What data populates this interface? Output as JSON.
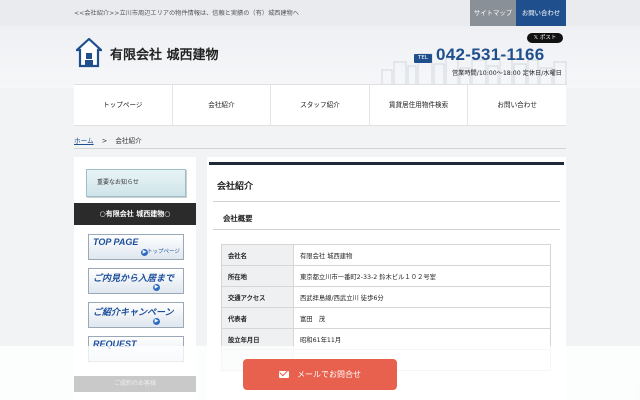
{
  "topbar": {
    "tagline": "<<会社紹介>>立川市周辺エリアの物件情報は、信頼と実績の（有）城西建物へ",
    "sitemap_label": "サイトマップ",
    "contact_label": "お問い合わせ"
  },
  "header": {
    "logo_text": "有限会社 城西建物",
    "post_label": "𝕏 ポスト",
    "tel_badge": "TEL",
    "tel_number": "042-531-1166",
    "hours": "営業時間/10:00～18:00 定休日/水曜日"
  },
  "nav": {
    "items": [
      {
        "label": "トップページ"
      },
      {
        "label": "会社紹介"
      },
      {
        "label": "スタッフ紹介"
      },
      {
        "label": "賃貸居住用物件検索"
      },
      {
        "label": "お問い合わせ"
      }
    ]
  },
  "breadcrumb": {
    "home": "ホーム",
    "separator": ">",
    "current": "会社紹介"
  },
  "sidebar": {
    "notice_label": "重要なお知らせ",
    "company_label": "○有限会社 城西建物○",
    "banners": [
      {
        "big": "TOP PAGE",
        "small": "トップページ"
      },
      {
        "big": "ご内見から入居まで",
        "small": ""
      },
      {
        "big": "ご紹介キャンペーン",
        "small": ""
      },
      {
        "big": "REQUEST",
        "small": ""
      }
    ],
    "faded_label": "ご成約のお客様"
  },
  "main": {
    "page_title": "会社紹介",
    "section_title": "会社概要",
    "rows": [
      {
        "label": "会社名",
        "value": "有限会社 城西建物"
      },
      {
        "label": "所在地",
        "value": "東京都立川市一番町2-33-2 鈴木ビル１０２号室"
      },
      {
        "label": "交通アクセス",
        "value": "西武拝島線/西武立川 徒歩6分"
      },
      {
        "label": "代表者",
        "value": "富田　茂"
      },
      {
        "label": "設立年月日",
        "value": "昭和61年11月"
      },
      {
        "label": "",
        "value": ""
      }
    ]
  },
  "mail_button": {
    "label": "メールでお問合せ"
  },
  "colors": {
    "brand": "#1f4f8c",
    "mail_button": "#e8614e",
    "company_bar": "#2b2b2b"
  }
}
